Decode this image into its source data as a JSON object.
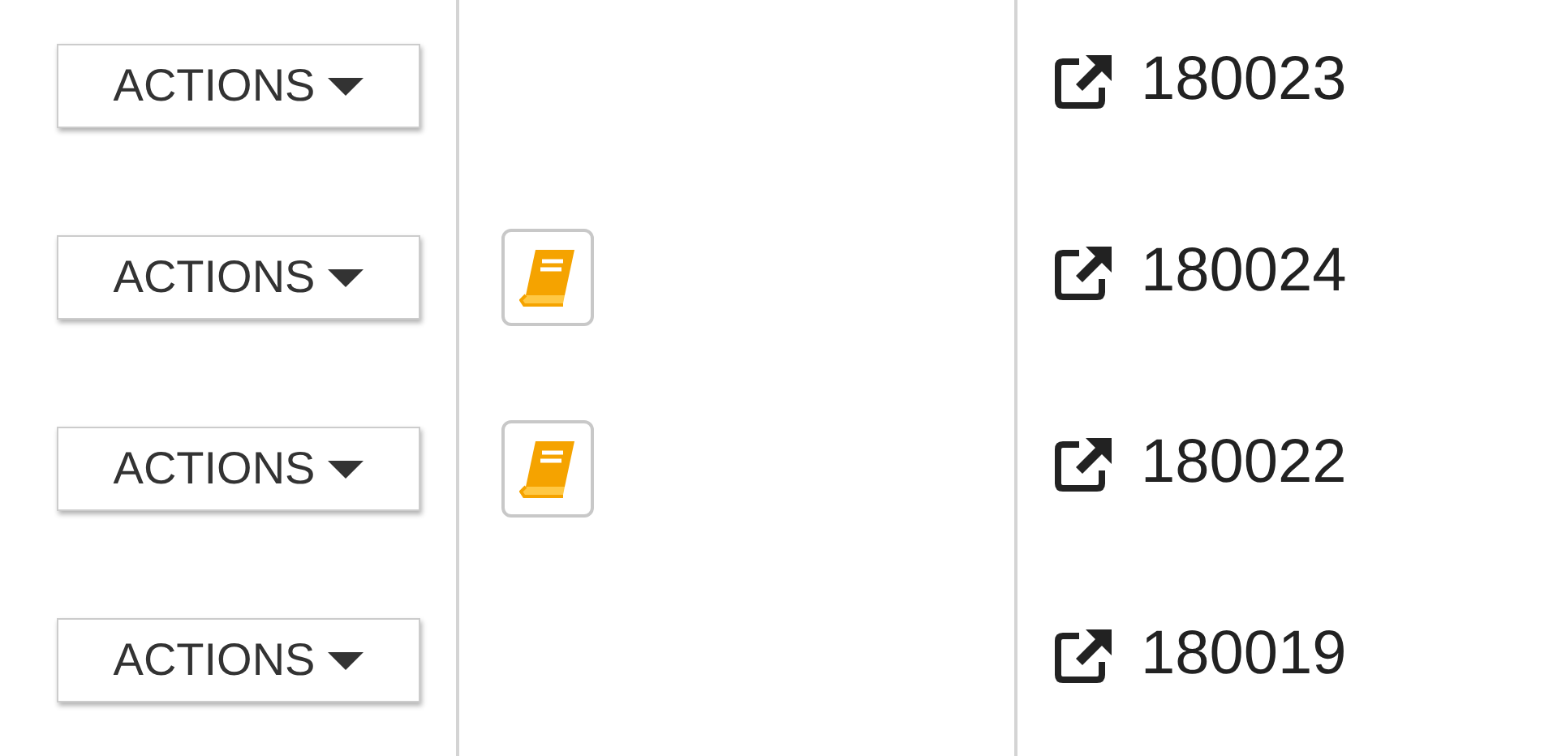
{
  "rows": [
    {
      "action_label": "ACTIONS",
      "has_notes": false,
      "id": "180023"
    },
    {
      "action_label": "ACTIONS",
      "has_notes": true,
      "id": "180024"
    },
    {
      "action_label": "ACTIONS",
      "has_notes": true,
      "id": "180022"
    },
    {
      "action_label": "ACTIONS",
      "has_notes": false,
      "id": "180019"
    }
  ]
}
